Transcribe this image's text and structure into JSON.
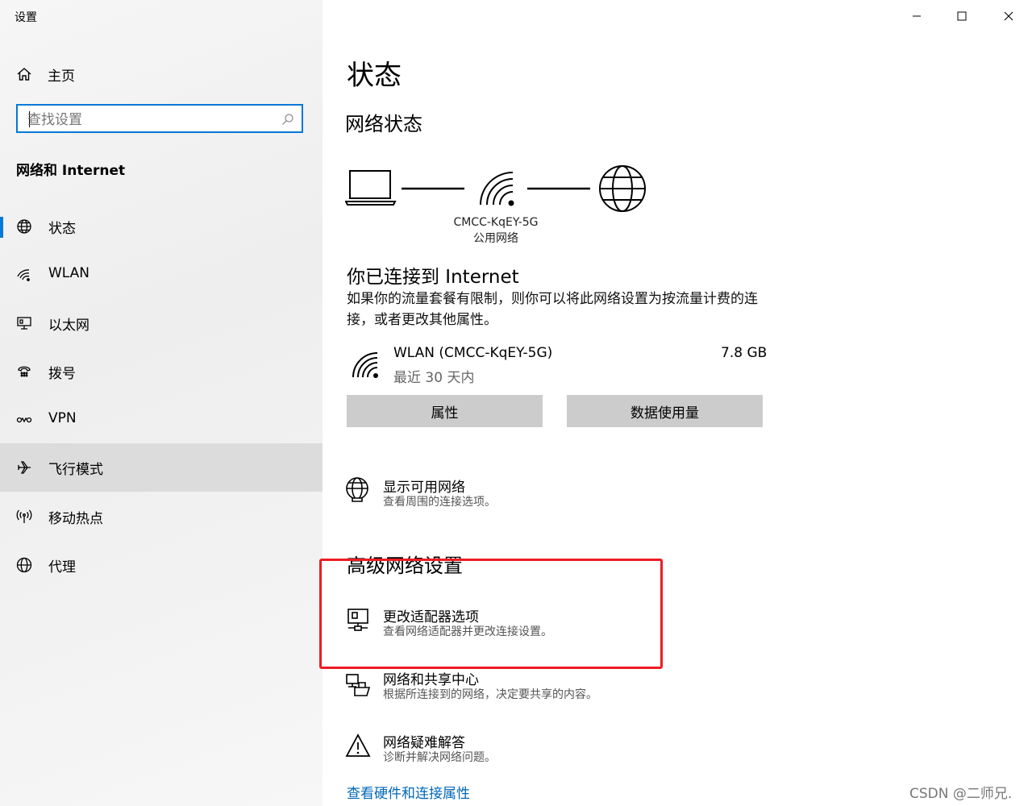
{
  "app": {
    "title": "设置"
  },
  "sidebar": {
    "home_label": "主页",
    "search_placeholder": "查找设置",
    "section_title": "网络和 Internet",
    "items": [
      {
        "label": "状态",
        "icon": "status-globe-icon",
        "active": true
      },
      {
        "label": "WLAN",
        "icon": "wifi-icon"
      },
      {
        "label": "以太网",
        "icon": "ethernet-icon"
      },
      {
        "label": "拨号",
        "icon": "dialup-icon"
      },
      {
        "label": "VPN",
        "icon": "vpn-icon"
      },
      {
        "label": "飞行模式",
        "icon": "airplane-icon",
        "hovered": true
      },
      {
        "label": "移动热点",
        "icon": "hotspot-icon"
      },
      {
        "label": "代理",
        "icon": "proxy-globe-icon"
      }
    ]
  },
  "window_controls": [
    "minimize",
    "maximize",
    "close"
  ],
  "main": {
    "title": "状态",
    "network_status_heading": "网络状态",
    "network_name": "CMCC-KqEY-5G",
    "network_type": "公用网络",
    "connected_heading": "你已连接到 Internet",
    "connected_desc": "如果你的流量套餐有限制，则你可以将此网络设置为按流量计费的连接，或者更改其他属性。",
    "connection": {
      "name": "WLAN (CMCC-KqEY-5G)",
      "period": "最近 30 天内",
      "usage": "7.8 GB"
    },
    "buttons": {
      "properties": "属性",
      "data_usage": "数据使用量"
    },
    "show_networks": {
      "title": "显示可用网络",
      "subtitle": "查看周围的连接选项。"
    },
    "advanced_heading": "高级网络设置",
    "advanced_items": [
      {
        "title": "更改适配器选项",
        "subtitle": "查看网络适配器并更改连接设置。"
      },
      {
        "title": "网络和共享中心",
        "subtitle": "根据所连接到的网络，决定要共享的内容。"
      },
      {
        "title": "网络疑难解答",
        "subtitle": "诊断并解决网络问题。"
      }
    ],
    "hardware_link": "查看硬件和连接属性"
  },
  "colors": {
    "accent": "#0078d7",
    "highlight_box": "#ee1c24",
    "link": "#0067b8"
  },
  "watermark": "CSDN @二师兄."
}
